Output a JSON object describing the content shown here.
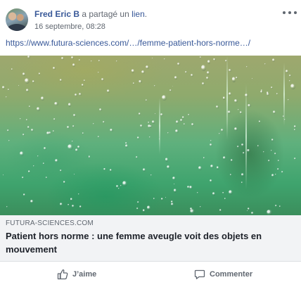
{
  "post": {
    "author": "Fred Eric B",
    "verb": " a partagé un ",
    "link_word": "lien",
    "verb_end": ".",
    "date": "16 septembre, 08:28",
    "url": "https://www.futura-sciences.com/…/femme-patient-hors-norme…/"
  },
  "link_preview": {
    "domain": "FUTURA-SCIENCES.COM",
    "title": "Patient hors norme : une femme aveugle voit des objets en mouvement"
  },
  "actions": {
    "like_label": "J’aime",
    "comment_label": "Commenter"
  },
  "icons": {
    "more": "more-options-icon",
    "like": "thumbs-up-icon",
    "comment": "speech-bubble-icon"
  },
  "colors": {
    "link_blue": "#385898",
    "muted_gray": "#606770",
    "caption_bg": "#f2f3f5"
  }
}
